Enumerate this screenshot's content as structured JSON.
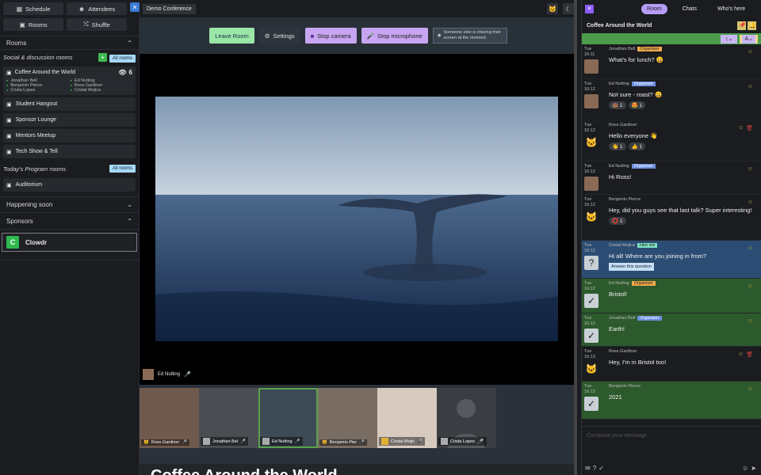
{
  "sidebar": {
    "schedule_label": "Schedule",
    "attendees_label": "Attendees",
    "rooms_btn_label": "Rooms",
    "shuffle_label": "Shuffle",
    "rooms_section_label": "Rooms",
    "social_label": "Social & discussion rooms",
    "all_rooms_label": "All rooms",
    "featured_room": {
      "name": "Coffee Around the World",
      "viewer_count": "6",
      "people": [
        "Jonathan Bell",
        "Ed Nutting",
        "Benjamin Pierce",
        "Ross Gardiner",
        "Crista Lopes",
        "Cristal Mojica"
      ]
    },
    "rooms": [
      "Student Hangout",
      "Sponsor Lounge",
      "Mentors Meetup",
      "Tech Show & Tell"
    ],
    "program_label": "Today's Program rooms",
    "program_all_label": "All rooms",
    "program_rooms": [
      "Auditorium"
    ],
    "happening_label": "Happening soon",
    "sponsors_label": "Sponsors",
    "sponsor_name": "Clowdr",
    "sponsor_logo": "C"
  },
  "center": {
    "conference_label": "Demo Conference",
    "leave_label": "Leave Room",
    "settings_label": "Settings",
    "camera_label": "Stop camera",
    "mic_label": "Stop microphone",
    "sharing_note": "Someone else is sharing their screen at the moment",
    "speaker_name": "Ed Nutting",
    "participants": [
      {
        "name": "Ross Gardiner",
        "bg": "#6f5a4d"
      },
      {
        "name": "Jonathan Bel",
        "bg": "#4a4d52"
      },
      {
        "name": "Ed Nutting",
        "bg": "#3f4a57"
      },
      {
        "name": "Benjamin Pier",
        "bg": "#7a6e64"
      },
      {
        "name": "Cristal Mojic",
        "bg": "#d7cbc0"
      },
      {
        "name": "Crista Lopes",
        "bg": "#3a3d42"
      }
    ],
    "room_title": "Coffee Around the World"
  },
  "chat": {
    "tab_room": "Room",
    "tab_chats": "Chats",
    "tab_whos_here": "Who's here",
    "room_name": "Coffee Around the World",
    "compose_placeholder": "Compose your message",
    "messages": [
      {
        "day": "Tue",
        "time": "16:11",
        "author": "Jonathan Bell",
        "badge": "Organiser",
        "text": "What's for lunch? 😀",
        "kind": "normal",
        "reactions": []
      },
      {
        "day": "Tue",
        "time": "16:12",
        "author": "Ed Nutting",
        "badge": "Organiser",
        "text": "Not sure - roast? 😀",
        "kind": "normal",
        "reactions": [
          "🍩 1",
          "😍 1"
        ]
      },
      {
        "day": "Tue",
        "time": "16:12",
        "author": "Ross Gardiner",
        "badge": "",
        "text": "Hello everyone 👋",
        "kind": "normal",
        "reactions": [
          "👋 1",
          "👍 1"
        ]
      },
      {
        "day": "Tue",
        "time": "16:12",
        "author": "Ed Nutting",
        "badge": "Organiser",
        "text": "Hi Ross!",
        "kind": "normal",
        "reactions": []
      },
      {
        "day": "Tue",
        "time": "16:12",
        "author": "Benjamin Pierce",
        "badge": "",
        "text": "Hey, did you guys see that last talk? Super interesting!",
        "kind": "normal",
        "reactions": [
          "⭕ 1"
        ]
      },
      {
        "day": "Tue",
        "time": "16:12",
        "author": "Cristal Mojica",
        "badge": "Hire me",
        "text": "Hi all! Where are you joining in from?",
        "kind": "question",
        "reactions": [],
        "action": "Answer this question"
      },
      {
        "day": "Tue",
        "time": "16:12",
        "author": "Ed Nutting",
        "badge": "Organiser",
        "text": "Bristol!",
        "kind": "answer",
        "reactions": []
      },
      {
        "day": "Tue",
        "time": "16:12",
        "author": "Jonathan Bell",
        "badge": "Organiser",
        "text": "Earth!",
        "kind": "answer",
        "reactions": []
      },
      {
        "day": "Tue",
        "time": "16:13",
        "author": "Ross Gardiner",
        "badge": "",
        "text": "Hey, I'm in Bristol too!",
        "kind": "normal",
        "reactions": []
      },
      {
        "day": "Tue",
        "time": "16:13",
        "author": "Benjamin Pierce",
        "badge": "",
        "text": "2021",
        "kind": "answer",
        "reactions": []
      }
    ]
  }
}
